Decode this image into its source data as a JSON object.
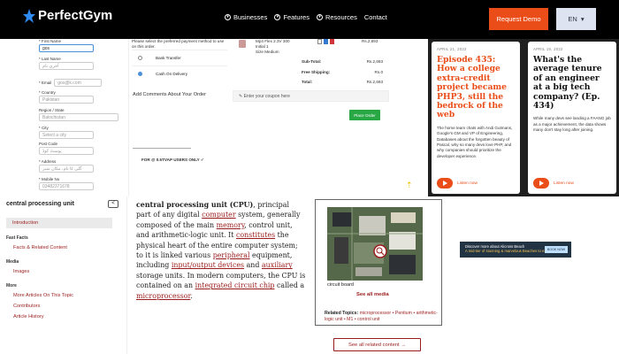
{
  "nav": {
    "logo": "PerfectGym",
    "links": [
      "Businesses",
      "Features",
      "Resources",
      "Contact"
    ],
    "demo_label": "Request Demo",
    "lang_label": "EN"
  },
  "checkout": {
    "first_name_label": "* First Name",
    "first_name_value": "gos",
    "last_name_label": "* Last Name",
    "last_name_placeholder": "آخری نام",
    "email_label": "* Email",
    "email_value": "gos@k.com",
    "country_label": "* Country",
    "country_value": "Pakistan",
    "region_label": "Region / State",
    "region_value": "Balochistan",
    "city_label": "* City",
    "city_value": "Select a city",
    "postcode_label": "Post Code",
    "postcode_placeholder": "پوسٹ کوڈ",
    "address_label": "* Address",
    "address_placeholder": "گلی کا نام، مکان نمبر",
    "mobile_label": "* Mobile No",
    "mobile_value": "03482371678",
    "payment_prompt": "Please select the preferred payment method to use on this order.",
    "payment_options": [
      "Bank Transfer",
      "Cash On Delivery"
    ],
    "comments_label": "Add Comments About Your Order",
    "buy_strip": "FOR @ 0.5TVAP USERS ONLY ✓",
    "product_lines": [
      "Mp4 Flex 2.3V 300",
      "Initial 1",
      "Size Medium"
    ],
    "product_price": "Rs.2,693",
    "subtotal_label": "Sub-Total:",
    "subtotal_value": "Rs.2,693",
    "shipping_label": "Free Shipping:",
    "shipping_value": "Rs.0",
    "total_label": "Total:",
    "total_value": "Rs.2,693",
    "coupon_label": "Enter your coupon here",
    "place_order_label": "Place Order"
  },
  "cards": [
    {
      "date": "APRIL 21, 2022",
      "title": "Episode 435: How a college extra-credit project became PHP3, still the bedrock of the web",
      "desc": "The home team chats with Andi Gutmans, Google's GM and VP of Engineering, Databases about the forgotten beauty of Pascal, why so many devs love PHP, and why companies should prioritize the developer experience.",
      "listen": "Listen now"
    },
    {
      "date": "APRIL 19, 2022",
      "title": "What's the average tenure of an engineer at a big tech company? (Ep. 434)",
      "desc": "While many devs see landing a FAANG job as a major achievement, the data shows many don't stay long after joining.",
      "listen": "Listen now"
    }
  ],
  "sidebar": {
    "title": "central processing unit",
    "collapse_icon": "<",
    "intro": "Introduction",
    "fast_facts": "Fast Facts",
    "fast_facts_link": "Facts & Related Content",
    "media": "Media",
    "media_link": "Images",
    "more": "More",
    "more_links": [
      "More Articles On This Topic",
      "Contributors",
      "Article History"
    ]
  },
  "article": {
    "term": "central processing unit (CPU)",
    "t1": ", principal part of any digital ",
    "l1": "computer",
    "t2": " system, generally composed of the main ",
    "l2": "memory",
    "t3": ", control unit, and arithmetic-logic unit. It ",
    "l3": "constitutes",
    "t4": " the physical heart of the entire computer system; to it is linked various ",
    "l4": "peripheral",
    "t5": " equipment, including ",
    "l5": "input/output devices",
    "t6": " and ",
    "l6": "auxiliary",
    "t7": " storage units. In modern computers, the CPU is contained on an ",
    "l7": "integrated circuit chip",
    "t8": " called a ",
    "l8": "microprocessor",
    "t9": "."
  },
  "media_panel": {
    "caption": "circuit board",
    "see_media": "See all media",
    "related_label": "Related Topics:",
    "related_links": "microprocessor • Pentium • arithmetic-logic unit • M1 • control unit",
    "see_all_related": "See all related content →"
  },
  "ad": {
    "text": "Discover more about Alicross Beach",
    "sub": "A mid-tier of stunning & marvelous Beaches to explore",
    "btn": "BOOK NOW"
  },
  "colors": {
    "accent_orange": "#ea4d18",
    "britannica_red": "#9b1c1c",
    "order_green": "#28a745"
  }
}
